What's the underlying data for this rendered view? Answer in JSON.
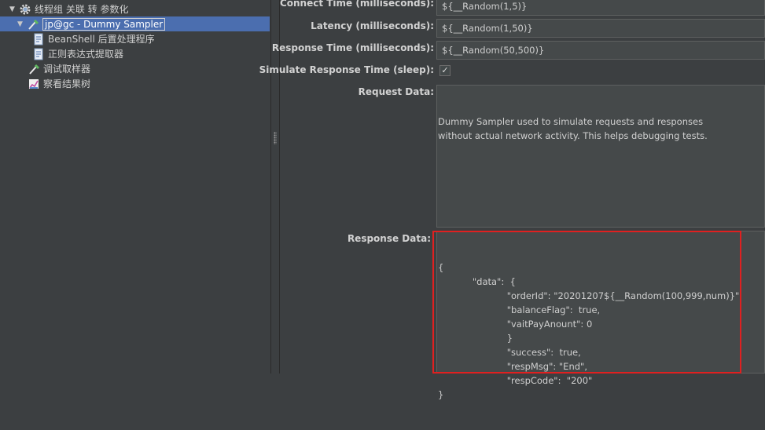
{
  "tree": {
    "items": [
      {
        "label": "线程组 关联 转 参数化",
        "arrow": "▼",
        "icon": "gear-icon"
      },
      {
        "label": "jp@gc - Dummy Sampler",
        "arrow": "▼",
        "icon": "pipette-icon"
      },
      {
        "label": "BeanShell 后置处理程序",
        "icon": "script-icon"
      },
      {
        "label": "正则表达式提取器",
        "icon": "script-icon"
      },
      {
        "label": "调试取样器",
        "icon": "pipette-icon"
      },
      {
        "label": "察看结果树",
        "icon": "graph-icon"
      }
    ]
  },
  "form": {
    "connect_time_label": "Connect Time (milliseconds):",
    "connect_time_value": "${__Random(1,5)}",
    "latency_label": "Latency (milliseconds):",
    "latency_value": "${__Random(1,50)}",
    "response_time_label": "Response Time (milliseconds):",
    "response_time_value": "${__Random(50,500)}",
    "simulate_label": "Simulate Response Time (sleep):",
    "simulate_checked": "✓",
    "request_data_label": "Request Data:",
    "request_data_lines": [
      "Dummy Sampler used to simulate requests and responses",
      "without actual network activity. This helps debugging tests."
    ],
    "response_data_label": "Response Data:",
    "response_data_lines": [
      "{",
      "            \"data\":  {",
      "                        \"orderId\": \"20201207${__Random(100,999,num)}\",",
      "                        \"balanceFlag\":  true,",
      "                        \"vaitPayAnount\": 0",
      "                        }",
      "                        \"success\":  true,",
      "                        \"respMsg\": \"End\",",
      "                        \"respCode\":  \"200\"",
      "}"
    ]
  }
}
